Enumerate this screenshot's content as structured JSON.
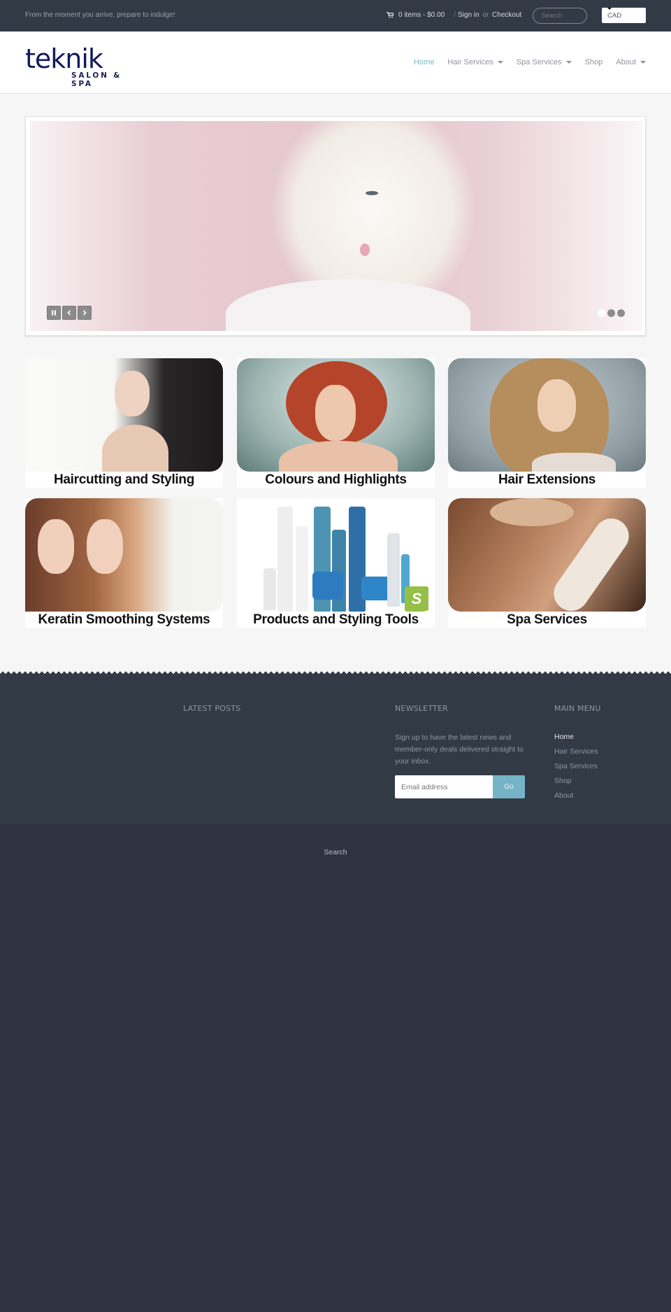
{
  "topbar": {
    "tagline": "From the moment you arrive, prepare to indulge!",
    "cart_icon": "shopping-cart-icon",
    "cart_text": "0 items - $0.00",
    "separator": "/",
    "sign_in": "Sign in",
    "or": "or",
    "checkout": "Checkout",
    "search_placeholder": "Search",
    "currency": "CAD"
  },
  "header": {
    "logo_word": "teknik",
    "logo_sub": "SALON & SPA",
    "nav": [
      {
        "label": "Home",
        "active": true,
        "dropdown": false
      },
      {
        "label": "Hair Services",
        "active": false,
        "dropdown": true
      },
      {
        "label": "Spa Services",
        "active": false,
        "dropdown": true
      },
      {
        "label": "Shop",
        "active": false,
        "dropdown": false
      },
      {
        "label": "About",
        "active": false,
        "dropdown": true
      }
    ]
  },
  "slider": {
    "pause_icon": "pause-icon",
    "prev_icon": "chevron-left-icon",
    "next_icon": "chevron-right-icon",
    "slide_count": 3,
    "active_slide": 1
  },
  "tiles": [
    {
      "caption": "Haircutting and Styling"
    },
    {
      "caption": "Colours and Highlights"
    },
    {
      "caption": "Hair Extensions"
    },
    {
      "caption": "Keratin Smoothing Systems"
    },
    {
      "caption": "Products and Styling Tools"
    },
    {
      "caption": "Spa Services"
    }
  ],
  "footer": {
    "latest_posts_title": "LATEST POSTS",
    "newsletter_title": "NEWSLETTER",
    "newsletter_text": "Sign up to have the latest news and member-only deals delivered straight to your inbox.",
    "email_placeholder": "Email address",
    "go_label": "Go",
    "main_menu_title": "MAIN MENU",
    "menu": [
      {
        "label": "Home",
        "active": true
      },
      {
        "label": "Hair Services",
        "active": false
      },
      {
        "label": "Spa Services",
        "active": false
      },
      {
        "label": "Shop",
        "active": false
      },
      {
        "label": "About",
        "active": false
      }
    ],
    "bottom_search": "Search"
  },
  "colors": {
    "accent": "#7ab5c4",
    "topbar_bg": "#323a46",
    "footer_bg": "#323a46",
    "bottom_bg": "#2d3340",
    "go_button": "#75b4c6",
    "logo": "#121a5e"
  }
}
